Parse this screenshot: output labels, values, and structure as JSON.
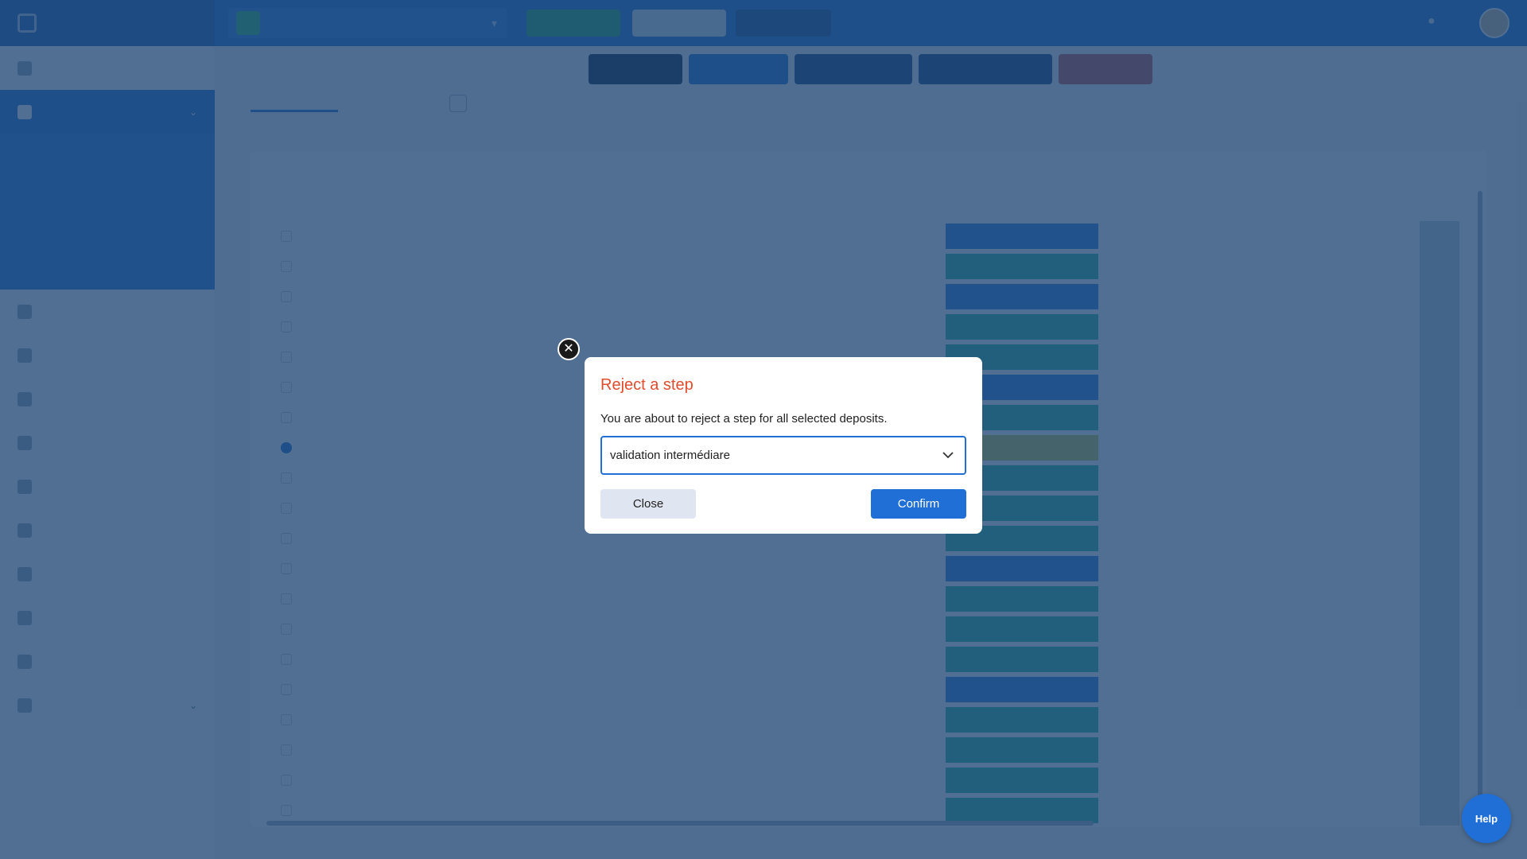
{
  "modal": {
    "title": "Reject a step",
    "message": "You are about to reject a step for all selected deposits.",
    "select_value": "validation intermédiare",
    "close_label": "Close",
    "confirm_label": "Confirm"
  },
  "help": {
    "label": "Help"
  },
  "colors": {
    "accent": "#1f6fd6",
    "title_red": "#e04c2c",
    "overlay": "#1f4673"
  },
  "background": {
    "sidebar": {
      "items": [
        {
          "icon": "dashboard-icon"
        },
        {
          "icon": "deposits-icon",
          "active": true
        },
        {
          "icon": "users-icon"
        },
        {
          "icon": "stats-icon"
        },
        {
          "icon": "documents-icon"
        },
        {
          "icon": "mail-icon"
        },
        {
          "icon": "people-icon"
        },
        {
          "icon": "calendar-icon"
        },
        {
          "icon": "chart-icon"
        },
        {
          "icon": "settings-icon"
        },
        {
          "icon": "tools-icon"
        },
        {
          "icon": "config-icon"
        }
      ],
      "sub_items": 4
    },
    "table": {
      "status_colors": [
        "blue",
        "green",
        "blue",
        "green",
        "green",
        "blue",
        "green",
        "yellow",
        "green",
        "green",
        "green",
        "blue",
        "green",
        "green",
        "green",
        "blue",
        "green",
        "green",
        "green",
        "green"
      ]
    }
  }
}
